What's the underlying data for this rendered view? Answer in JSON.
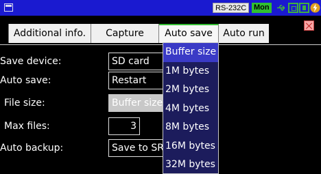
{
  "status_bar": {
    "rs_label": "RS-232C",
    "mon_label": "Mon"
  },
  "tabs": [
    {
      "label": "Additional info."
    },
    {
      "label": "Capture buffer"
    },
    {
      "label": "Auto save"
    },
    {
      "label": "Auto run"
    }
  ],
  "active_tab": "Auto save",
  "form": {
    "save_device": {
      "label": "Save device:",
      "value": "SD card"
    },
    "auto_save": {
      "label": "Auto save:",
      "value": "Restart"
    },
    "file_size": {
      "label": "File size:",
      "value": "Buffer size"
    },
    "max_files": {
      "label": "Max files:",
      "value": "3"
    },
    "auto_backup": {
      "label": "Auto backup:",
      "value": "Save to SRA"
    }
  },
  "file_size_dropdown": {
    "options": [
      "Buffer size",
      "1M bytes",
      "2M bytes",
      "4M bytes",
      "8M bytes",
      "16M bytes",
      "32M bytes"
    ],
    "selected": "Buffer size"
  },
  "colors": {
    "title_bar": "#1a1ad0",
    "active_tab_accent": "#36c036",
    "dropdown_bg": "#1c1c5c",
    "dropdown_highlight": "#3a3ac6"
  }
}
